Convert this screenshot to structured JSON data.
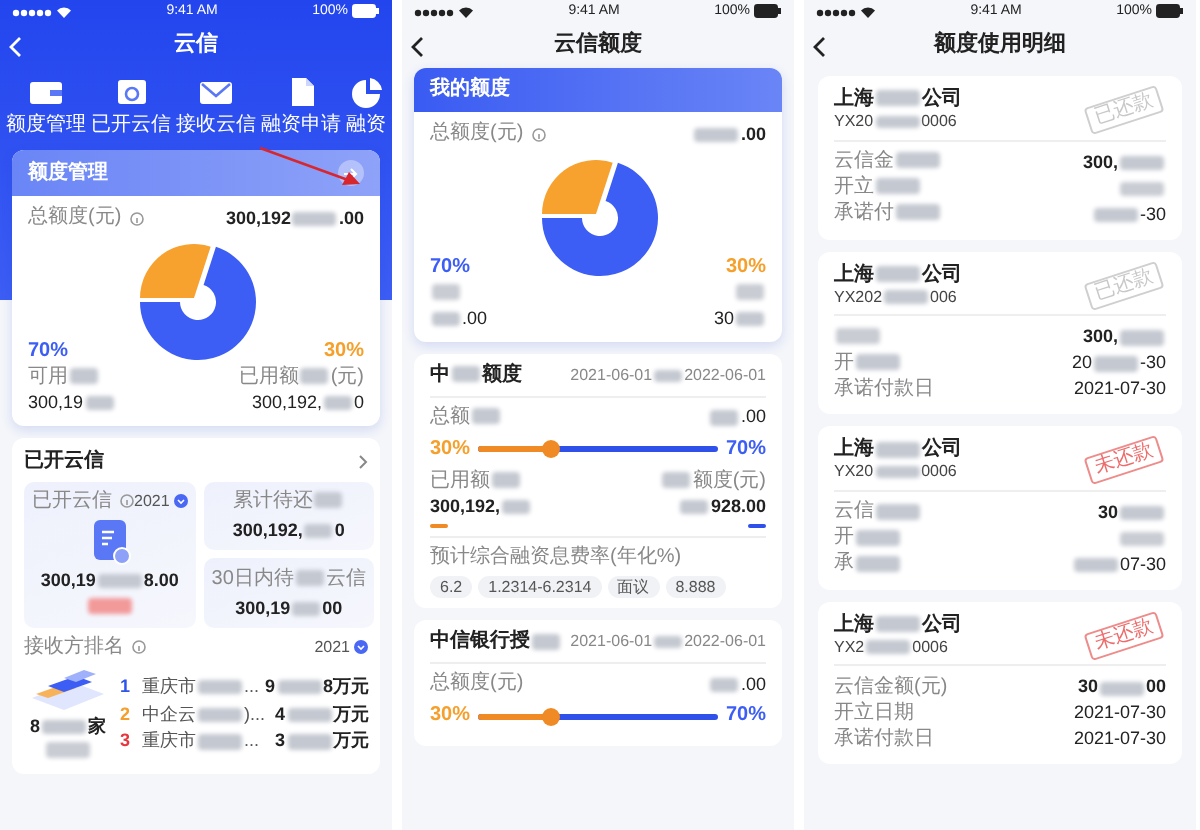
{
  "home": {
    "status_bar": {
      "time": "9:41 AM",
      "battery": "100%"
    },
    "title": "云信",
    "quick_actions": [
      {
        "label": "额度管理",
        "kind": "wallet"
      },
      {
        "label": "已开云信",
        "kind": "card"
      },
      {
        "label": "接收云信",
        "kind": "envelope"
      },
      {
        "label": "融资申请",
        "kind": "document"
      },
      {
        "label": "融资",
        "kind": "pie"
      }
    ],
    "quota_card": {
      "title": "额度管理",
      "total_label": "总额度(元)",
      "total": {
        "pre": "300,192",
        "post": ".00"
      },
      "chart_data": {
        "type": "pie",
        "values": [
          70,
          30
        ]
      },
      "left": {
        "percent": "70%",
        "label": {
          "pre": "可用"
        },
        "value": {
          "pre": "300,19"
        }
      },
      "right": {
        "percent": "30%",
        "label": {
          "pre": "已用额",
          "post": "(元)"
        },
        "value": {
          "pre": "300,192,",
          "post": "0"
        }
      }
    },
    "annotation_arrow": true,
    "opened": {
      "title": "已开云信",
      "main_tile": {
        "label": "已开云信",
        "year": "2021",
        "value": {
          "pre": "300,19",
          "post": "8.00"
        },
        "note": {
          "kind": "danger"
        }
      },
      "tiles": [
        {
          "label": {
            "pre": "累计待还"
          },
          "value": {
            "pre": "300,192,",
            "post": "0"
          }
        },
        {
          "label": {
            "pre": "30日内待",
            "post": "云信"
          },
          "value": {
            "pre": "300,19",
            "post": "00"
          }
        }
      ],
      "ranking_label": "接收方排名",
      "ranking_year": "2021",
      "summary": {
        "pre": "8",
        "post": "家"
      },
      "summary_note": {
        "blurred": true
      },
      "ranking": [
        {
          "rank": "1",
          "color": "#2f54eb",
          "name": {
            "pre": "重庆市",
            "post": "..."
          },
          "amount": {
            "pre": "9",
            "post": "8万元"
          }
        },
        {
          "rank": "2",
          "color": "#f5a02c",
          "name": {
            "pre": "中企云",
            "post": ")..."
          },
          "amount": {
            "pre": "4",
            "post": "万元"
          }
        },
        {
          "rank": "3",
          "color": "#e5373d",
          "name": {
            "pre": "重庆市",
            "post": "..."
          },
          "amount": {
            "pre": "3",
            "post": "万元"
          }
        }
      ]
    }
  },
  "credit": {
    "status_bar": {
      "time": "9:41 AM",
      "battery": "100%"
    },
    "title": "云信额度",
    "quota_card": {
      "title": "我的额度",
      "total_label": "总额度(元)",
      "total": {
        "post": ".00"
      },
      "chart_data": {
        "type": "pie",
        "values": [
          70,
          30
        ]
      },
      "left": {
        "percent": "70%",
        "label": {
          "blurred": true
        },
        "value": {
          "post": ".00"
        }
      },
      "right": {
        "percent": "30%",
        "label": {
          "blurred": true
        },
        "value": {
          "pre": "30"
        }
      }
    },
    "lines": [
      {
        "bank": {
          "pre": "中",
          "post": "额度"
        },
        "period": {
          "pre": "2021-06-01",
          "post": "2022-06-01"
        },
        "total_label": {
          "pre": "总额"
        },
        "total": {
          "post": ".00"
        },
        "used_percent": "30%",
        "free_percent": "70%",
        "level": 0.3,
        "used_label": {
          "pre": "已用额"
        },
        "used": {
          "pre": "300,192,"
        },
        "free_label": {
          "post": "额度(元)"
        },
        "free": {
          "post": "928.00"
        },
        "rate_label": "预计综合融资息费率(年化%)",
        "rates": [
          "6.2",
          "1.2314-6.2314",
          "面议",
          "8.888"
        ]
      },
      {
        "bank": {
          "pre": "中信银行授"
        },
        "period": {
          "pre": "2021-06-01",
          "post": "2022-06-01"
        },
        "total_label": "总额度(元)",
        "total": {
          "post": ".00"
        },
        "used_percent": "30%",
        "free_percent": "70%",
        "level": 0.3
      }
    ]
  },
  "usage": {
    "status_bar": {
      "time": "9:41 AM",
      "battery": "100%"
    },
    "title": "额度使用明细",
    "records": [
      {
        "company": {
          "pre": "上海",
          "post": "公司"
        },
        "code": {
          "pre": "YX20",
          "post": "0006"
        },
        "stamp": "已还款",
        "kind": "repaid",
        "amount_label": {
          "pre": "云信金"
        },
        "amount": {
          "pre": "300,"
        },
        "open_label": {
          "pre": "开立"
        },
        "open_date": {
          "blurred": true
        },
        "due_label": {
          "pre": "承诺付"
        },
        "due_date": {
          "post": "-30"
        }
      },
      {
        "company": {
          "pre": "上海",
          "post": "公司"
        },
        "code": {
          "pre": "YX202",
          "post": "006"
        },
        "stamp": "已还款",
        "kind": "repaid",
        "amount_label": {
          "blurred": true
        },
        "amount": {
          "pre": "300,"
        },
        "open_label": {
          "pre": "开"
        },
        "open_date": {
          "pre": "20",
          "post": "-30"
        },
        "due_label": "承诺付款日",
        "due_date": "2021-07-30"
      },
      {
        "company": {
          "pre": "上海",
          "post": "公司"
        },
        "code": {
          "pre": "YX20",
          "post": "0006"
        },
        "stamp": "未还款",
        "kind": "unpaid",
        "amount_label": {
          "pre": "云信"
        },
        "amount": {
          "pre": "30"
        },
        "open_label": {
          "pre": "开"
        },
        "open_date": {
          "blurred": true
        },
        "due_label": {
          "pre": "承"
        },
        "due_date": {
          "post": "07-30"
        }
      },
      {
        "company": {
          "pre": "上海",
          "post": "公司"
        },
        "code": {
          "pre": "YX2",
          "post": "0006"
        },
        "stamp": "未还款",
        "kind": "unpaid",
        "amount_label": "云信金额(元)",
        "amount": {
          "pre": "30",
          "post": "00"
        },
        "open_label": "开立日期",
        "open_date": "2021-07-30",
        "due_label": "承诺付款日",
        "due_date": "2021-07-30"
      }
    ]
  }
}
